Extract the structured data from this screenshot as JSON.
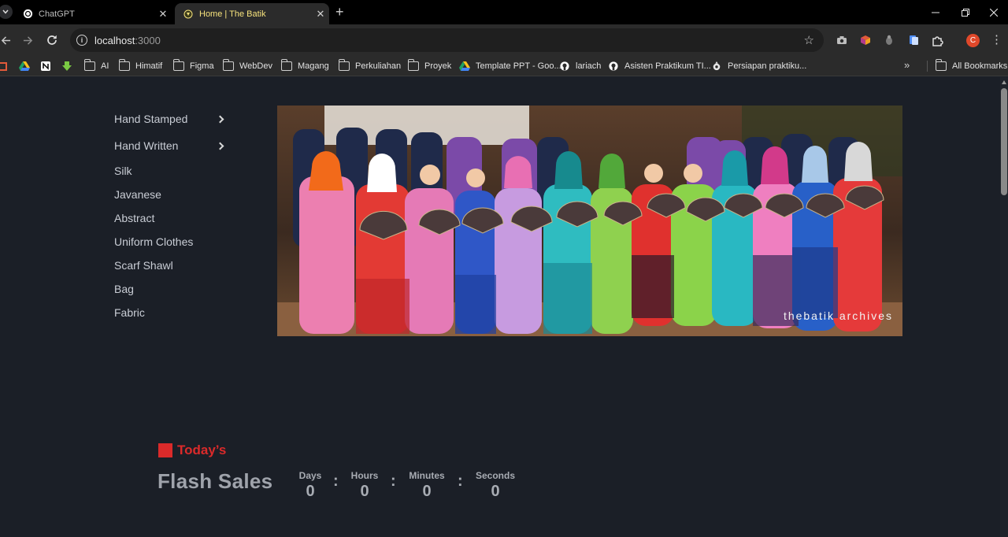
{
  "browser": {
    "tabs": [
      {
        "title": "ChatGPT",
        "icon": "chatgpt-icon",
        "active": false
      },
      {
        "title": "Home | The Batik",
        "icon": "site-favicon",
        "active": true
      }
    ],
    "address": {
      "host": "localhost",
      "port": ":3000"
    },
    "profile_initial": "C",
    "bookmarks": [
      {
        "label": "AI",
        "icon": "folder-icon"
      },
      {
        "label": "Himatif",
        "icon": "folder-icon"
      },
      {
        "label": "Figma",
        "icon": "folder-icon"
      },
      {
        "label": "WebDev",
        "icon": "folder-icon"
      },
      {
        "label": "Magang",
        "icon": "folder-icon"
      },
      {
        "label": "Perkuliahan",
        "icon": "folder-icon"
      },
      {
        "label": "Proyek",
        "icon": "folder-icon"
      },
      {
        "label": "Template PPT - Goo...",
        "icon": "google-drive-icon"
      },
      {
        "label": "lariach",
        "icon": "github-icon"
      },
      {
        "label": "Asisten Praktikum TI...",
        "icon": "github-icon"
      },
      {
        "label": "Persiapan praktiku...",
        "icon": "site-icon"
      }
    ],
    "all_bookmarks": "All Bookmarks"
  },
  "sidebar": {
    "items": [
      {
        "label": "Hand Stamped",
        "has_submenu": true
      },
      {
        "label": "Hand Written",
        "has_submenu": true
      },
      {
        "label": "Silk",
        "has_submenu": false
      },
      {
        "label": "Javanese",
        "has_submenu": false
      },
      {
        "label": "Abstract",
        "has_submenu": false
      },
      {
        "label": "Uniform Clothes",
        "has_submenu": false
      },
      {
        "label": "Scarf Shawl",
        "has_submenu": false
      },
      {
        "label": "Bag",
        "has_submenu": false
      },
      {
        "label": "Fabric",
        "has_submenu": false
      }
    ]
  },
  "hero": {
    "watermark": "thebatik archives"
  },
  "flash": {
    "tag": "Today’s",
    "title": "Flash Sales",
    "countdown": [
      {
        "label": "Days",
        "value": "0"
      },
      {
        "label": "Hours",
        "value": "0"
      },
      {
        "label": "Minutes",
        "value": "0"
      },
      {
        "label": "Seconds",
        "value": "0"
      }
    ],
    "separator": ":"
  },
  "colors": {
    "accent": "#db2a2a",
    "page_bg": "#1b1f27",
    "tab_title_active": "#f6e27c"
  }
}
